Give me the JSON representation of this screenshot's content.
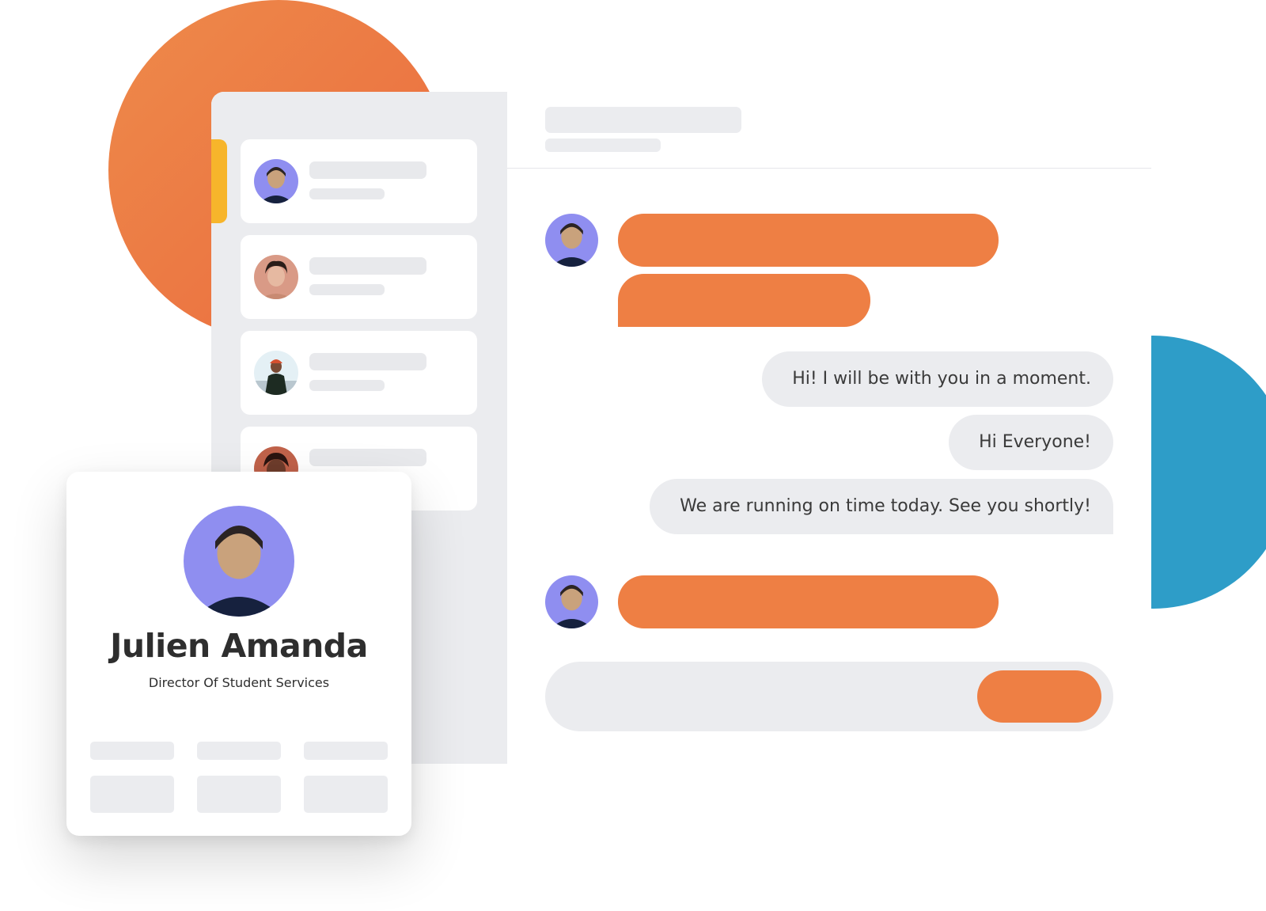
{
  "colors": {
    "accent_orange": "#ee7f44",
    "accent_blue": "#2e9dc8",
    "active_indicator": "#f7b52b",
    "skeleton_gray": "#ebecef",
    "avatar_purple": "#8f8ef0"
  },
  "sidebar": {
    "conversations": [
      {
        "avatar": "person-avatar-icon",
        "active": true
      },
      {
        "avatar": "person-avatar-icon",
        "active": false
      },
      {
        "avatar": "person-avatar-icon",
        "active": false
      },
      {
        "avatar": "person-avatar-icon",
        "active": false
      }
    ]
  },
  "chat": {
    "messages": {
      "reply_1": "Hi! I will be with you in a moment.",
      "reply_2": "Hi Everyone!",
      "reply_3": "We are running on time today. See you shortly!"
    },
    "send_icon": "send-button"
  },
  "profile": {
    "name": "Julien Amanda",
    "role": "Director Of Student Services"
  }
}
